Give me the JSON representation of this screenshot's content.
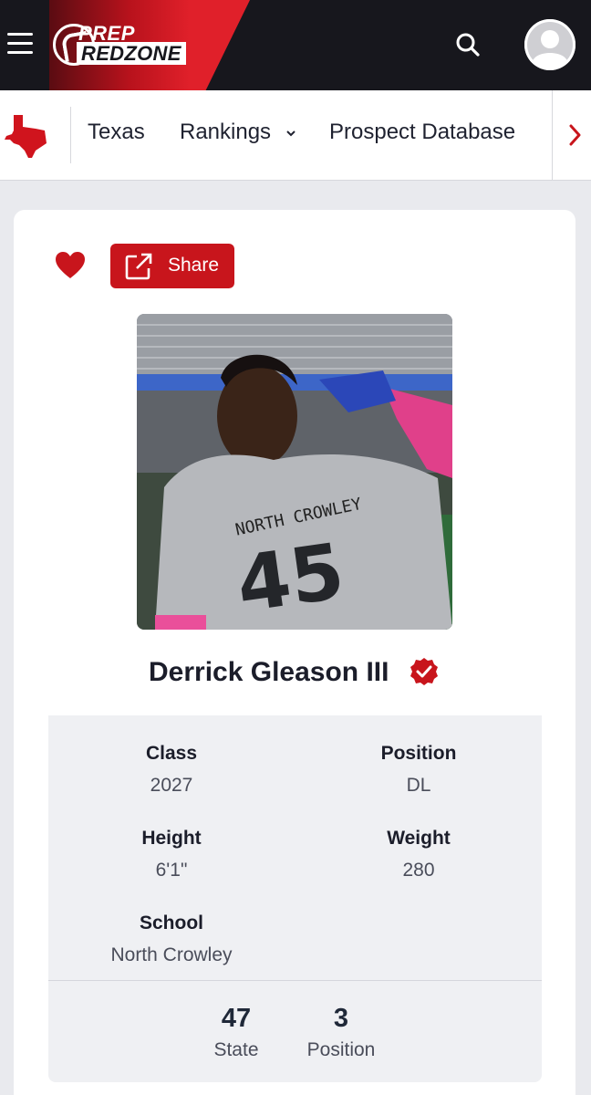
{
  "header": {
    "logo_line1": "PREP",
    "logo_line2": "REDZONE",
    "icons": {
      "menu": "hamburger-menu-icon",
      "search": "search-icon",
      "account": "user-avatar-icon"
    }
  },
  "nav": {
    "state_icon": "texas-state-icon",
    "items": [
      {
        "label": "Texas"
      },
      {
        "label": "Rankings",
        "has_dropdown": true
      },
      {
        "label": "Prospect Database"
      }
    ],
    "next_icon": "chevron-right-icon"
  },
  "profile": {
    "share_label": "Share",
    "name": "Derrick Gleason III",
    "verified": true,
    "details": [
      {
        "key": "Class",
        "value": "2027"
      },
      {
        "key": "Position",
        "value": "DL"
      },
      {
        "key": "Height",
        "value": "6'1\""
      },
      {
        "key": "Weight",
        "value": "280"
      },
      {
        "key": "School",
        "value": "North Crowley"
      }
    ],
    "ranks": [
      {
        "number": "47",
        "label": "State"
      },
      {
        "number": "3",
        "label": "Position"
      }
    ]
  },
  "colors": {
    "brand_red": "#c8151c",
    "header_dark": "#17171d",
    "page_bg": "#e9eaee"
  }
}
